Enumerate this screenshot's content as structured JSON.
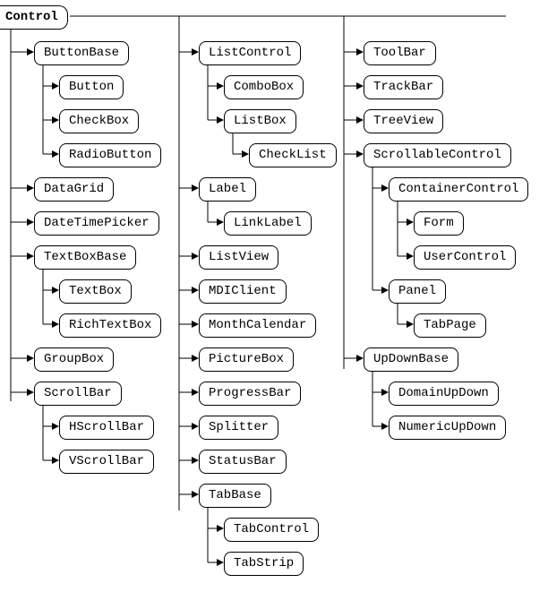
{
  "tree": {
    "root": "Control",
    "col1": {
      "ButtonBase": {
        "label": "ButtonBase",
        "children": [
          "Button",
          "CheckBox",
          "RadioButton"
        ]
      },
      "DataGrid": {
        "label": "DataGrid"
      },
      "DateTimePicker": {
        "label": "DateTimePicker"
      },
      "TextBoxBase": {
        "label": "TextBoxBase",
        "children": [
          "TextBox",
          "RichTextBox"
        ]
      },
      "GroupBox": {
        "label": "GroupBox"
      },
      "ScrollBar": {
        "label": "ScrollBar",
        "children": [
          "HScrollBar",
          "VScrollBar"
        ]
      }
    },
    "col2": {
      "ListControl": {
        "label": "ListControl",
        "children": [
          "ComboBox",
          {
            "label": "ListBox",
            "children": [
              "CheckList"
            ]
          }
        ]
      },
      "Label": {
        "label": "Label",
        "children": [
          "LinkLabel"
        ]
      },
      "ListView": {
        "label": "ListView"
      },
      "MDIClient": {
        "label": "MDIClient"
      },
      "MonthCalendar": {
        "label": "MonthCalendar"
      },
      "PictureBox": {
        "label": "PictureBox"
      },
      "ProgressBar": {
        "label": "ProgressBar"
      },
      "Splitter": {
        "label": "Splitter"
      },
      "StatusBar": {
        "label": "StatusBar"
      },
      "TabBase": {
        "label": "TabBase",
        "children": [
          "TabControl",
          "TabStrip"
        ]
      }
    },
    "col3": {
      "ToolBar": {
        "label": "ToolBar"
      },
      "TrackBar": {
        "label": "TrackBar"
      },
      "TreeView": {
        "label": "TreeView"
      },
      "ScrollableControl": {
        "label": "ScrollableControl",
        "children": [
          {
            "label": "ContainerControl",
            "children": [
              "Form",
              "UserControl"
            ]
          },
          {
            "label": "Panel",
            "children": [
              "TabPage"
            ]
          }
        ]
      },
      "UpDownBase": {
        "label": "UpDownBase",
        "children": [
          "DomainUpDown",
          "NumericUpDown"
        ]
      }
    }
  }
}
